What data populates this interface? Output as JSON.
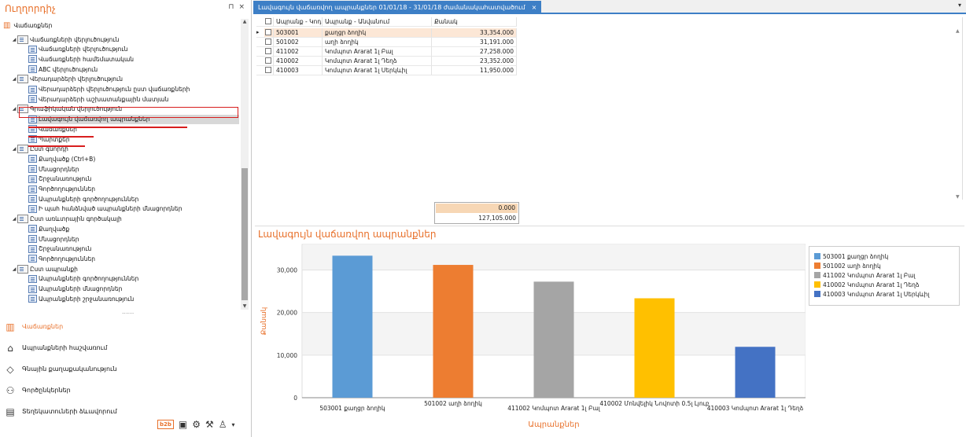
{
  "left_panel": {
    "title": "Ուղղորդիչ",
    "pin_glyph": "⊓",
    "close_glyph": "×",
    "root_label": "Վաճառքներ",
    "tree": [
      {
        "label": "Վաճառքների վերլուծություն",
        "level": 1
      },
      {
        "label": "Վաճառքների վերլուծություն",
        "level": 2
      },
      {
        "label": "Վաճառքների համեմատական",
        "level": 2
      },
      {
        "label": "ABC վերլուծություն",
        "level": 2
      },
      {
        "label": "Վերադարձերի վերլուծություն",
        "level": 1
      },
      {
        "label": "Վերադարձերի վերլուծություն ըստ վաճառքների",
        "level": 2
      },
      {
        "label": "Վերադարձերի աշխատանքային մատյան",
        "level": 2
      },
      {
        "label": "Գրաֆիկական վերլուծություն",
        "level": 1
      },
      {
        "label": "Լավագույն վաճառվող ապրանքներ",
        "level": 2
      },
      {
        "label": "Վաճառքներ",
        "level": 2
      },
      {
        "label": "Պարտքեր",
        "level": 2
      },
      {
        "label": "Ըստ գնորդի",
        "level": 1
      },
      {
        "label": "Քաղվածք (Ctrl+B)",
        "level": 2
      },
      {
        "label": "Մնացորդներ",
        "level": 2
      },
      {
        "label": "Շրջանառություն",
        "level": 2
      },
      {
        "label": "Գործողություններ",
        "level": 2
      },
      {
        "label": "Ապրանքների գործողություններ",
        "level": 2
      },
      {
        "label": "Ի պահ հանձնված ապրանքների մնացորդներ",
        "level": 2
      },
      {
        "label": "Ըստ առևտրային գործակալի",
        "level": 1
      },
      {
        "label": "Քաղվածք",
        "level": 2
      },
      {
        "label": "Մնացորդներ",
        "level": 2
      },
      {
        "label": "Շրջանառություն",
        "level": 2
      },
      {
        "label": "Գործողություններ",
        "level": 2
      },
      {
        "label": "Ըստ ապրանքի",
        "level": 1
      },
      {
        "label": "Ապրանքների գործողություններ",
        "level": 2
      },
      {
        "label": "Ապրանքների մնացորդներ",
        "level": 2
      },
      {
        "label": "Ապրանքների շրջանառություն",
        "level": 2
      }
    ],
    "more_glyph": "......",
    "nav": [
      {
        "label": "Վաճառքներ",
        "icon": "chart-icon",
        "glyph": "▥"
      },
      {
        "label": "Ապրանքների հաշվառում",
        "icon": "building-icon",
        "glyph": "⌂"
      },
      {
        "label": "Գնային քաղաքականություն",
        "icon": "tag-icon",
        "glyph": "◇"
      },
      {
        "label": "Գործընկերներ",
        "icon": "person-icon",
        "glyph": "⚇"
      },
      {
        "label": "Տեղեկատուների ձևավորում",
        "icon": "catalog-icon",
        "glyph": "▤"
      }
    ],
    "toolbar": {
      "b2b": "b2b",
      "clipboard": "▣",
      "user_settings": "⚙",
      "tools": "⚒",
      "user": "♙",
      "more": "▾"
    }
  },
  "document_tab": {
    "title": "Լավագույն վաճառվող ապրանքներ 01/01/18 - 31/01/18 ժամանակահատվածում",
    "close_glyph": "×",
    "menu_glyph": "▾"
  },
  "grid": {
    "columns": [
      "Ապրանք - Կոդ",
      "Ապրանք - Անվանում",
      "Քանակ"
    ],
    "rows": [
      {
        "code": "503001",
        "name": "քաղցր ձողիկ",
        "qty": "33,354.000"
      },
      {
        "code": "501002",
        "name": "աղի ձողիկ",
        "qty": "31,191.000"
      },
      {
        "code": "411002",
        "name": "Կոմպոտ Ararat 1լ Բալ",
        "qty": "27,258.000"
      },
      {
        "code": "410002",
        "name": "Կոմպոտ Ararat 1լ Դեղձ",
        "qty": "23,352.000"
      },
      {
        "code": "410003",
        "name": "Կոմպոտ Ararat 1լ Սերկևիլ",
        "qty": "11,950.000"
      }
    ],
    "totals": [
      "0.000",
      "127,105.000"
    ]
  },
  "chart_data": {
    "type": "bar",
    "title": "Լավագույն վաճառվող ապրանքներ",
    "xlabel": "Ապրանքներ",
    "ylabel": "Քանակ",
    "ylim": [
      0,
      36000
    ],
    "yticks": [
      0,
      10000,
      20000,
      30000
    ],
    "ytick_labels": [
      "0",
      "10,000",
      "20,000",
      "30,000"
    ],
    "categories": [
      "503001 քաղցր ձողիկ",
      "501002 աղի ձողիկ",
      "411002 Կոմպոտ Ararat 1լ Բալ",
      "410002 Մոնվելիկ Նովոտի 0.5լ Լյուբ",
      "410003 Կոմպոտ Ararat 1լ Դեղձ"
    ],
    "values": [
      33354,
      31191,
      27258,
      23352,
      11950
    ],
    "colors": [
      "#5b9bd5",
      "#ed7d31",
      "#a5a5a5",
      "#ffc000",
      "#4472c4"
    ],
    "legend": [
      "503001 քաղցր ձողիկ",
      "501002 աղի ձողիկ",
      "411002 Կոմպոտ Ararat 1լ Բալ",
      "410002 Կոմպոտ Ararat 1լ Դեղձ",
      "410003 Կոմպոտ Ararat 1լ Սերկևիլ"
    ],
    "legend_position": "right",
    "grid": true
  }
}
